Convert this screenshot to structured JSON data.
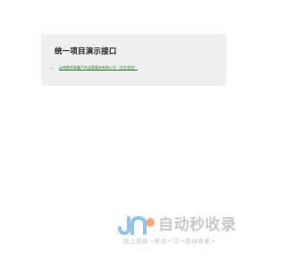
{
  "card": {
    "title": "统一项目演示接口",
    "links": [
      {
        "label": "云南欧尚赛鑫汽车运营服务有限公司（全生态型）"
      }
    ]
  },
  "watermark": {
    "brand": "自动秒收录",
    "slogan": "放上链接→来访一次→自动收录→",
    "colors": {
      "logo_blue": "#8fc3ea",
      "logo_orange": "#f3a97c",
      "text_gray": "#c9c9c9"
    }
  }
}
